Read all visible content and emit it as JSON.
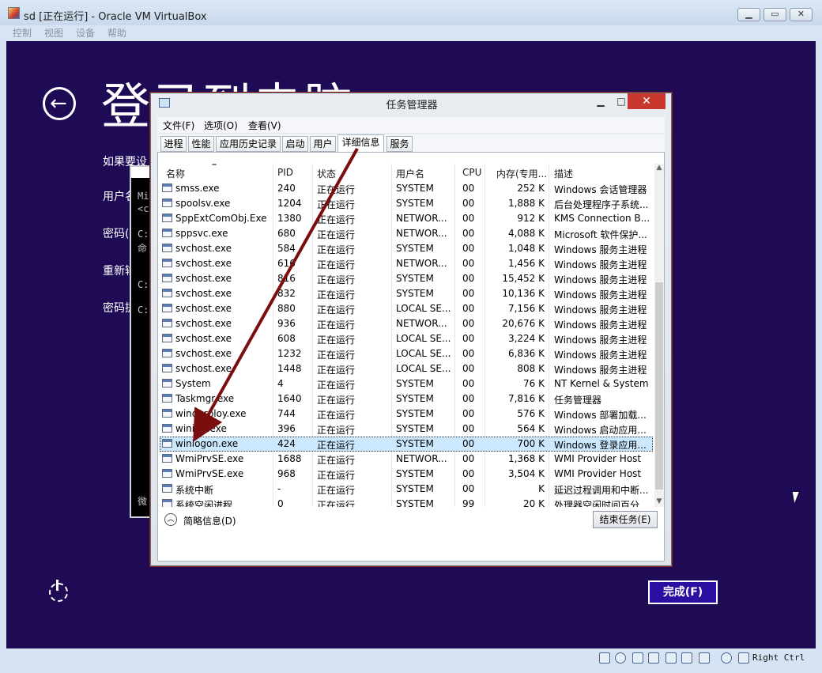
{
  "vbox": {
    "title": "sd [正在运行] - Oracle VM VirtualBox",
    "menu": [
      "控制",
      "视图",
      "设备",
      "帮助"
    ],
    "host_key": "Right Ctrl"
  },
  "login": {
    "back_arrow": "←",
    "title": "登录到电脑",
    "labels": [
      "如果要设",
      "用户名",
      "密码(",
      "重新输",
      "密码提"
    ],
    "finish_button": "完成(F)"
  },
  "cmd": {
    "lines": [
      "Mi",
      "<c",
      "C:",
      "命",
      "C:",
      "C:",
      "微"
    ]
  },
  "taskmgr": {
    "title": "任务管理器",
    "menu": [
      "文件(F)",
      "选项(O)",
      "查看(V)"
    ],
    "tabs": [
      "进程",
      "性能",
      "应用历史记录",
      "启动",
      "用户",
      "详细信息",
      "服务"
    ],
    "active_tab": "详细信息",
    "columns": [
      "名称",
      "PID",
      "状态",
      "用户名",
      "CPU",
      "内存(专用...",
      "描述"
    ],
    "rows": [
      {
        "name": "smss.exe",
        "pid": "240",
        "status": "正在运行",
        "user": "SYSTEM",
        "cpu": "00",
        "mem": "252 K",
        "desc": "Windows 会话管理器"
      },
      {
        "name": "spoolsv.exe",
        "pid": "1204",
        "status": "正在运行",
        "user": "SYSTEM",
        "cpu": "00",
        "mem": "1,888 K",
        "desc": "后台处理程序子系统..."
      },
      {
        "name": "SppExtComObj.Exe",
        "pid": "1380",
        "status": "正在运行",
        "user": "NETWOR...",
        "cpu": "00",
        "mem": "912 K",
        "desc": "KMS Connection B..."
      },
      {
        "name": "sppsvc.exe",
        "pid": "680",
        "status": "正在运行",
        "user": "NETWOR...",
        "cpu": "00",
        "mem": "4,088 K",
        "desc": "Microsoft 软件保护..."
      },
      {
        "name": "svchost.exe",
        "pid": "584",
        "status": "正在运行",
        "user": "SYSTEM",
        "cpu": "00",
        "mem": "1,048 K",
        "desc": "Windows 服务主进程"
      },
      {
        "name": "svchost.exe",
        "pid": "616",
        "status": "正在运行",
        "user": "NETWOR...",
        "cpu": "00",
        "mem": "1,456 K",
        "desc": "Windows 服务主进程"
      },
      {
        "name": "svchost.exe",
        "pid": "816",
        "status": "正在运行",
        "user": "SYSTEM",
        "cpu": "00",
        "mem": "15,452 K",
        "desc": "Windows 服务主进程"
      },
      {
        "name": "svchost.exe",
        "pid": "832",
        "status": "正在运行",
        "user": "SYSTEM",
        "cpu": "00",
        "mem": "10,136 K",
        "desc": "Windows 服务主进程"
      },
      {
        "name": "svchost.exe",
        "pid": "880",
        "status": "正在运行",
        "user": "LOCAL SE...",
        "cpu": "00",
        "mem": "7,156 K",
        "desc": "Windows 服务主进程"
      },
      {
        "name": "svchost.exe",
        "pid": "936",
        "status": "正在运行",
        "user": "NETWOR...",
        "cpu": "00",
        "mem": "20,676 K",
        "desc": "Windows 服务主进程"
      },
      {
        "name": "svchost.exe",
        "pid": "608",
        "status": "正在运行",
        "user": "LOCAL SE...",
        "cpu": "00",
        "mem": "3,224 K",
        "desc": "Windows 服务主进程"
      },
      {
        "name": "svchost.exe",
        "pid": "1232",
        "status": "正在运行",
        "user": "LOCAL SE...",
        "cpu": "00",
        "mem": "6,836 K",
        "desc": "Windows 服务主进程"
      },
      {
        "name": "svchost.exe",
        "pid": "1448",
        "status": "正在运行",
        "user": "LOCAL SE...",
        "cpu": "00",
        "mem": "808 K",
        "desc": "Windows 服务主进程"
      },
      {
        "name": "System",
        "pid": "4",
        "status": "正在运行",
        "user": "SYSTEM",
        "cpu": "00",
        "mem": "76 K",
        "desc": "NT Kernel & System"
      },
      {
        "name": "Taskmgr.exe",
        "pid": "1640",
        "status": "正在运行",
        "user": "SYSTEM",
        "cpu": "00",
        "mem": "7,816 K",
        "desc": "任务管理器"
      },
      {
        "name": "winderploy.exe",
        "pid": "744",
        "status": "正在运行",
        "user": "SYSTEM",
        "cpu": "00",
        "mem": "576 K",
        "desc": "Windows 部署加载..."
      },
      {
        "name": "wininit.exe",
        "pid": "396",
        "status": "正在运行",
        "user": "SYSTEM",
        "cpu": "00",
        "mem": "564 K",
        "desc": "Windows 启动应用..."
      },
      {
        "name": "winlogon.exe",
        "pid": "424",
        "status": "正在运行",
        "user": "SYSTEM",
        "cpu": "00",
        "mem": "700 K",
        "desc": "Windows 登录应用..."
      },
      {
        "name": "WmiPrvSE.exe",
        "pid": "1688",
        "status": "正在运行",
        "user": "NETWOR...",
        "cpu": "00",
        "mem": "1,368 K",
        "desc": "WMI Provider Host"
      },
      {
        "name": "WmiPrvSE.exe",
        "pid": "968",
        "status": "正在运行",
        "user": "SYSTEM",
        "cpu": "00",
        "mem": "3,504 K",
        "desc": "WMI Provider Host"
      },
      {
        "name": "系统中断",
        "pid": "-",
        "status": "正在运行",
        "user": "SYSTEM",
        "cpu": "00",
        "mem": "K",
        "desc": "延迟过程调用和中断..."
      },
      {
        "name": "系统空闲进程",
        "pid": "0",
        "status": "正在运行",
        "user": "SYSTEM",
        "cpu": "99",
        "mem": "20 K",
        "desc": "处理器空闲时间百分..."
      }
    ],
    "selected_row": "winlogon.exe",
    "brief_label": "简略信息(D)",
    "end_task_label": "结束任务(E)"
  }
}
